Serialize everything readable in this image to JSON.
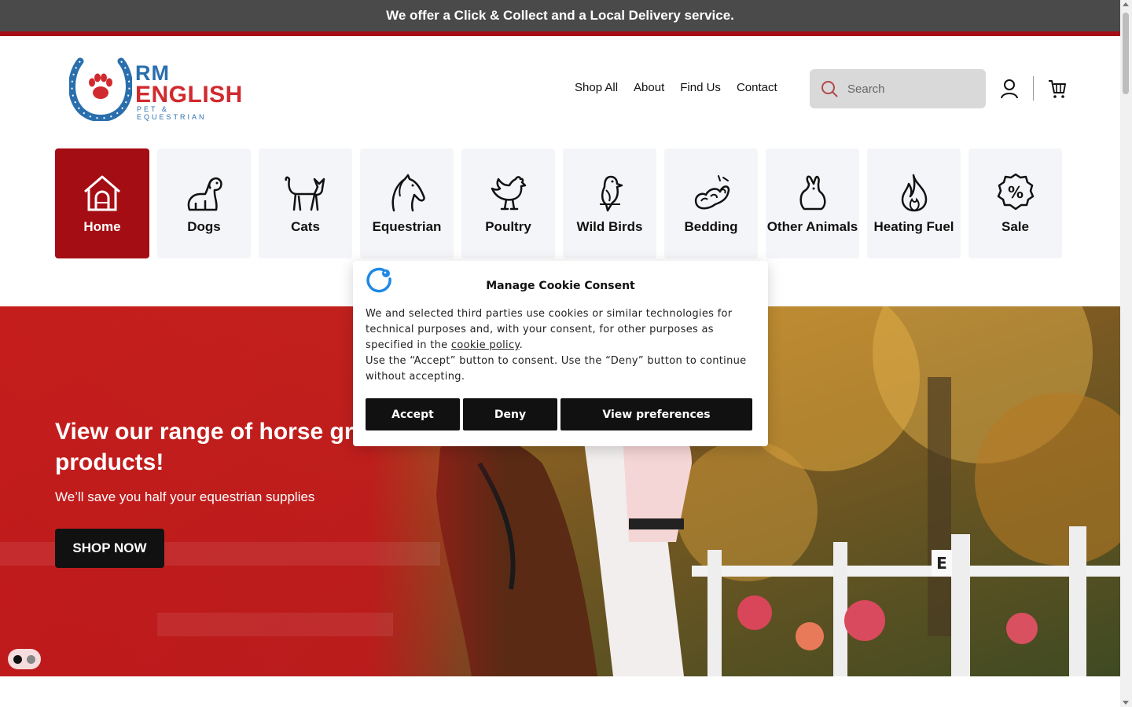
{
  "announcement": {
    "text": "We offer a Click & Collect and a Local Delivery service."
  },
  "logo": {
    "line1": "RM",
    "line2": "ENGLISH",
    "tagline": "PET & EQUESTRIAN",
    "icon": "horseshoe-paw-logo"
  },
  "nav": {
    "items": [
      "Shop All",
      "About",
      "Find Us",
      "Contact"
    ]
  },
  "search": {
    "placeholder": "Search",
    "icon": "search-icon"
  },
  "header_icons": {
    "account": "user-icon",
    "cart": "cart-icon"
  },
  "categories": [
    {
      "label": "Home",
      "icon": "house-icon",
      "active": true
    },
    {
      "label": "Dogs",
      "icon": "dog-icon"
    },
    {
      "label": "Cats",
      "icon": "cat-icon"
    },
    {
      "label": "Equestrian",
      "icon": "horse-icon"
    },
    {
      "label": "Poultry",
      "icon": "rooster-icon"
    },
    {
      "label": "Wild Birds",
      "icon": "bird-icon"
    },
    {
      "label": "Bedding",
      "icon": "bedding-icon"
    },
    {
      "label": "Other Animals",
      "icon": "rabbit-icon"
    },
    {
      "label": "Heating Fuel",
      "icon": "flame-icon"
    },
    {
      "label": "Sale",
      "icon": "sale-percent-icon"
    }
  ],
  "hero": {
    "title": "View our range of horse grooming products!",
    "subtitle": "We’ll save you half your equestrian supplies",
    "button": "SHOP NOW",
    "slides": 2,
    "active_slide": 1
  },
  "cookie": {
    "title": "Manage Cookie Consent",
    "body1": "We and selected third parties use cookies or similar technologies for technical purposes and, with your consent, for other purposes as specified in the ",
    "link": "cookie policy",
    "body1_end": ".",
    "body2": "Use the “Accept” button to consent. Use the “Deny” button to continue without accepting.",
    "accept": "Accept",
    "deny": "Deny",
    "preferences": "View preferences"
  },
  "colors": {
    "brand_red": "#a50d14",
    "announcement_bg": "#4a4a4a",
    "card_bg": "#f4f5f8"
  }
}
